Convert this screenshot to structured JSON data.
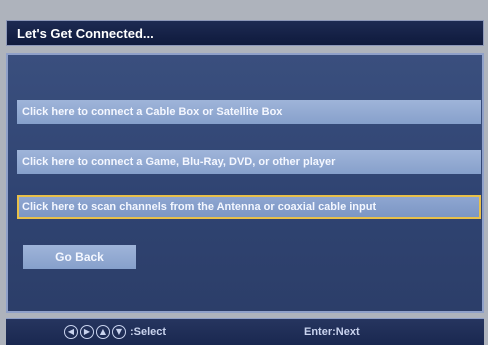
{
  "window": {
    "title": "Let's Get Connected..."
  },
  "options": [
    {
      "label": "Click here to connect a Cable Box or Satellite Box"
    },
    {
      "label": "Click here to connect a Game, Blu-Ray, DVD, or other player"
    },
    {
      "label": "Click here to scan channels from the Antenna or coaxial cable input"
    }
  ],
  "go_back_label": "Go Back",
  "footer": {
    "nav_icons": [
      "left-arrow-icon",
      "right-arrow-icon",
      "up-arrow-icon",
      "down-arrow-icon"
    ],
    "select_label": ":Select",
    "next_label": "Enter:Next"
  },
  "colors": {
    "panel": "#2f4371",
    "option": "#9fb4d9",
    "selection_outline": "#e8c04a",
    "title_bar": "#0f1a3d"
  }
}
